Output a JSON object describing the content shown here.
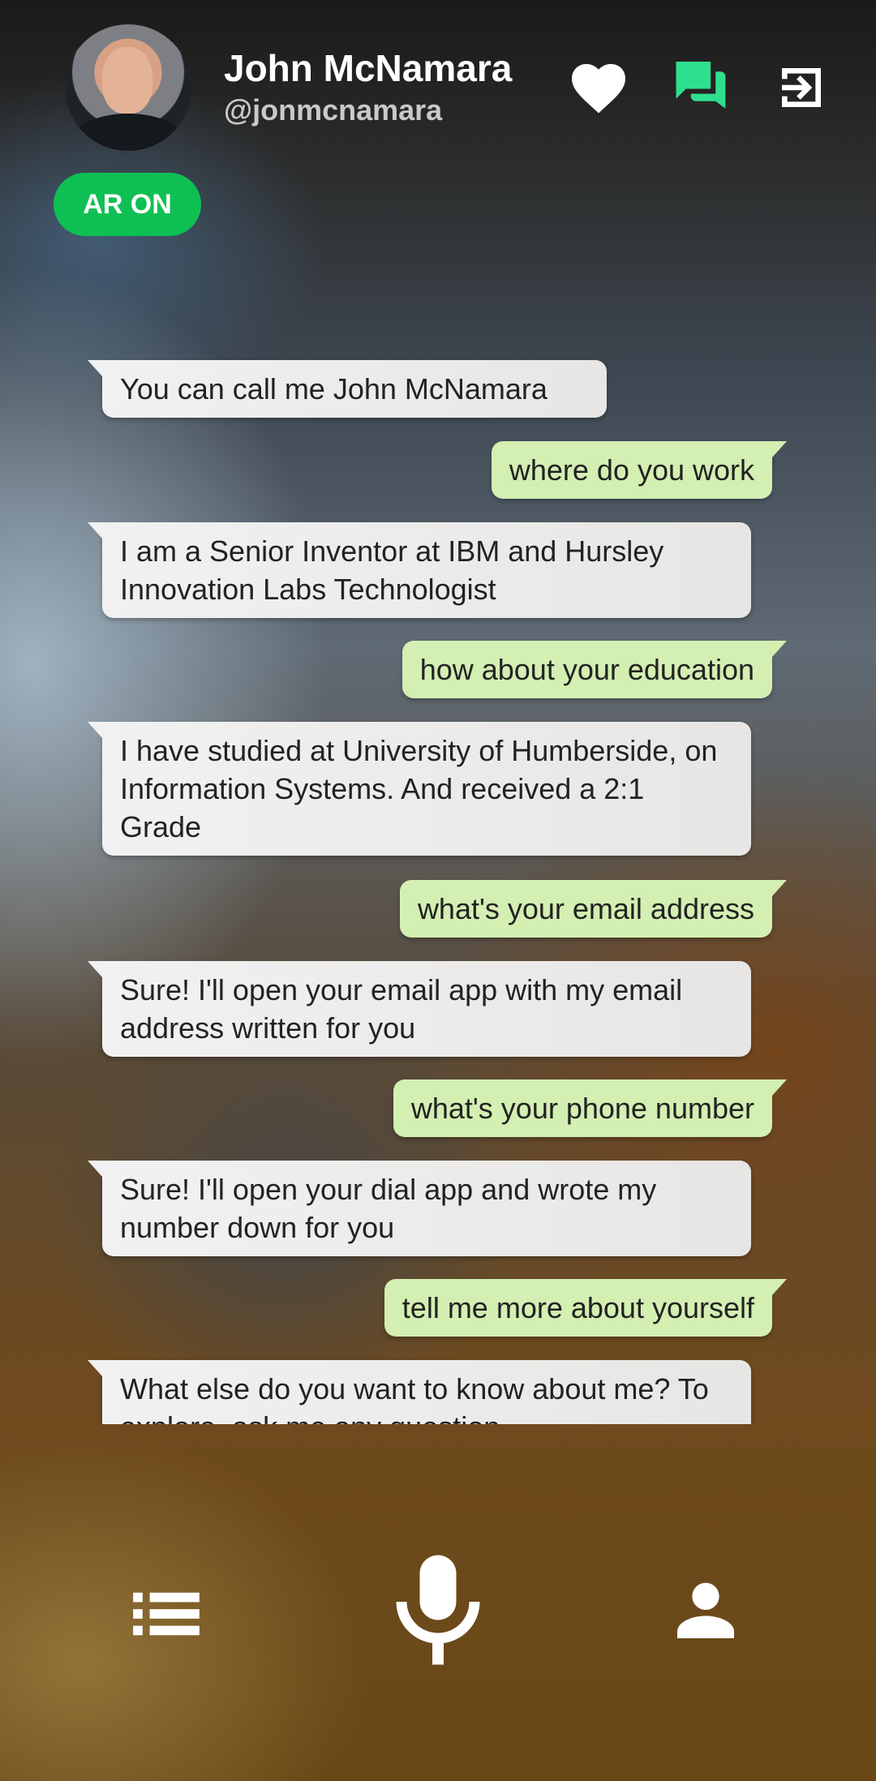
{
  "profile": {
    "name": "John McNamara",
    "handle": "@jonmcnamara",
    "ar_badge": "AR ON"
  },
  "header_icons": [
    "heart-icon",
    "chat-bubbles-icon",
    "exit-icon"
  ],
  "colors": {
    "ar_badge": "#0ec053",
    "active_icon": "#2ee08e",
    "user_bubble": "#d3efb2",
    "bot_bubble": "#efefef"
  },
  "messages": [
    {
      "from": "bot",
      "text": "You can call me John McNamara"
    },
    {
      "from": "user",
      "text": "where do you work"
    },
    {
      "from": "bot",
      "text": "I am a Senior Inventor at IBM and Hursley Innovation Labs Technologist"
    },
    {
      "from": "user",
      "text": "how about your education"
    },
    {
      "from": "bot",
      "text": "I have studied at University of Humberside, on Information Systems. And received a 2:1 Grade"
    },
    {
      "from": "user",
      "text": "what's your email address"
    },
    {
      "from": "bot",
      "text": "Sure! I'll open your email app with my email address written for you"
    },
    {
      "from": "user",
      "text": "what's your phone number"
    },
    {
      "from": "bot",
      "text": "Sure! I'll open your dial app and wrote my number down for you"
    },
    {
      "from": "user",
      "text": "tell me more about yourself"
    },
    {
      "from": "bot",
      "text": "What else do you want to know about me? To explore, ask me any question"
    }
  ],
  "bottom_icons": [
    "list-icon",
    "microphone-icon",
    "person-icon"
  ]
}
